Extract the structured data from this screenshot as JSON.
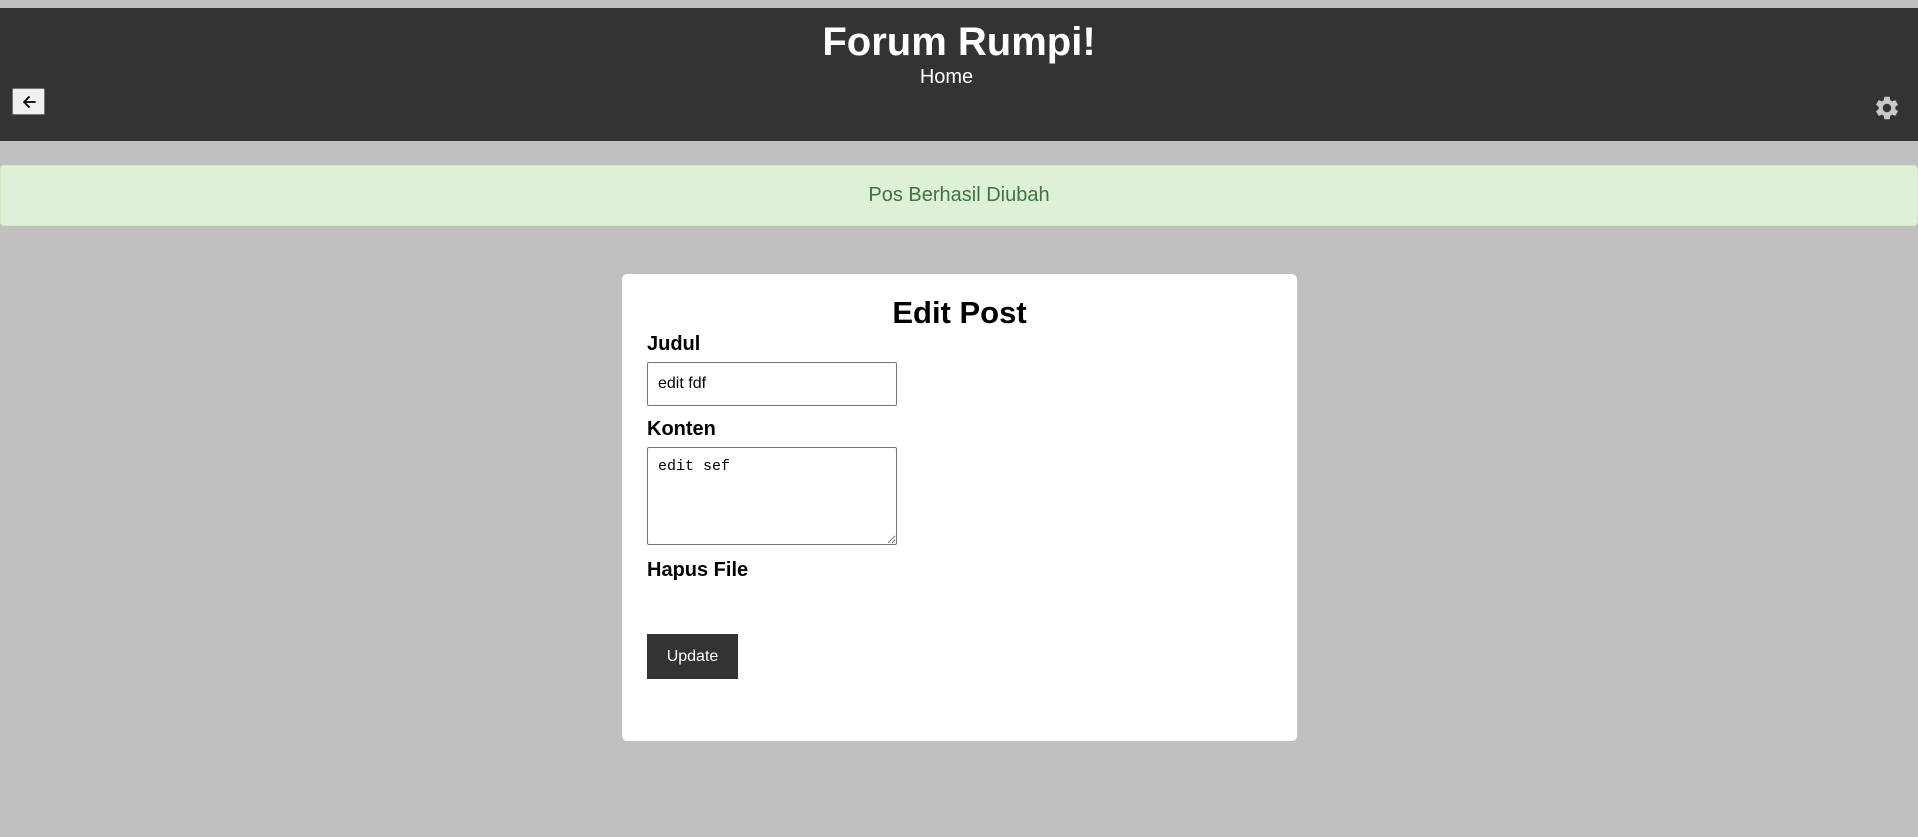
{
  "header": {
    "title": "Forum Rumpi!",
    "nav_home": "Home",
    "back_icon": "arrow-left-icon",
    "settings_icon": "gear-icon"
  },
  "alert": {
    "message": "Pos Berhasil Diubah"
  },
  "form": {
    "title": "Edit Post",
    "judul_label": "Judul",
    "judul_value": "edit fdf",
    "konten_label": "Konten",
    "konten_value": "edit sef",
    "hapus_file_label": "Hapus File",
    "submit_label": "Update"
  },
  "colors": {
    "header_bg": "#333333",
    "page_bg": "#c0c0c0",
    "alert_bg": "#dff0d8",
    "alert_text": "#3c763d",
    "button_bg": "#333333"
  }
}
